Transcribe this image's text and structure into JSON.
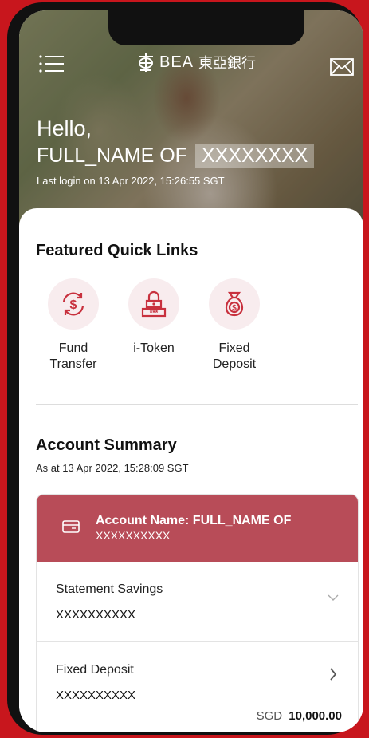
{
  "header": {
    "logo_text": "BEA",
    "logo_cn": "東亞銀行",
    "greeting": "Hello,",
    "name_prefix": "FULL_NAME OF",
    "name_masked": "XXXXXXXX",
    "last_login": "Last login on 13 Apr 2022, 15:26:55 SGT"
  },
  "quick_links": {
    "title": "Featured Quick Links",
    "items": [
      {
        "label": "Fund\nTransfer",
        "icon": "fund-transfer-icon"
      },
      {
        "label": "i-Token",
        "icon": "itoken-icon"
      },
      {
        "label": "Fixed\nDeposit",
        "icon": "fixed-deposit-icon"
      }
    ]
  },
  "account_summary": {
    "title": "Account Summary",
    "as_of": "As at 13 Apr 2022, 15:28:09 SGT",
    "account_name_line1": "Account Name: FULL_NAME OF",
    "account_name_line2": "XXXXXXXXXX",
    "rows": [
      {
        "title": "Statement Savings",
        "number": "XXXXXXXXXX"
      },
      {
        "title": "Fixed Deposit",
        "number": "XXXXXXXXXX",
        "currency": "SGD",
        "amount": "10,000.00"
      }
    ]
  },
  "colors": {
    "brand_red": "#c8161d",
    "account_header": "#b84c58",
    "icon_tint": "#c8313e"
  }
}
